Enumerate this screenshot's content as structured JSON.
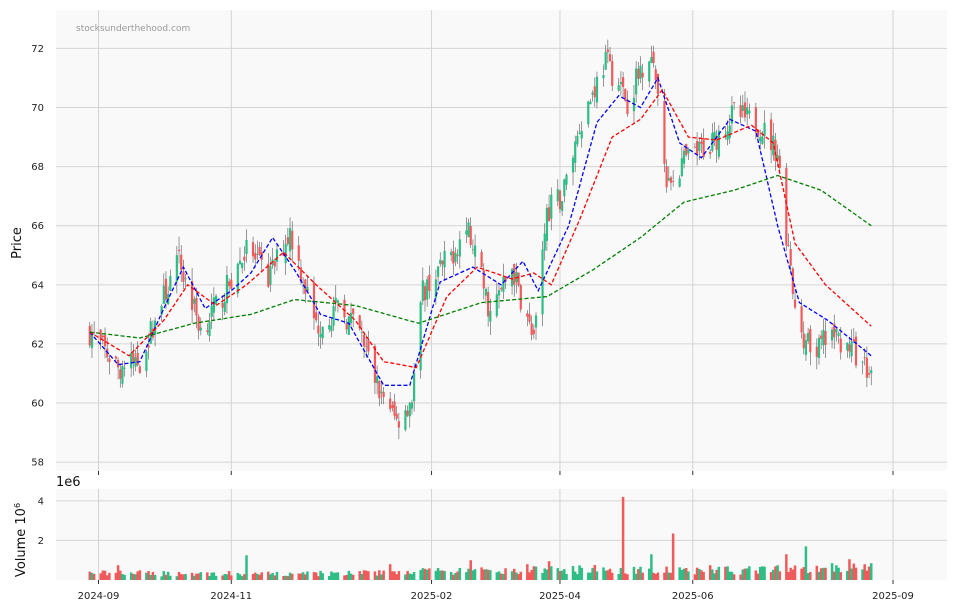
{
  "watermark": "stocksunderthehood.com",
  "chart_data": [
    {
      "type": "candlestick",
      "ylabel": "Price",
      "ylim": [
        57.7,
        73.3
      ],
      "yticks": [
        58,
        60,
        62,
        64,
        66,
        68,
        70,
        72
      ],
      "xticks": [
        "2024-09",
        "2024-11",
        "2025-02",
        "2025-04",
        "2025-06",
        "2025-09"
      ],
      "grid": true,
      "colors": {
        "up": "#2ebd85",
        "down": "#f05a5a",
        "ma_fast": "#0000ff",
        "ma_mid": "#ff0000",
        "ma_slow": "#008000"
      },
      "close_keypoints": [
        {
          "date": "2024-08-28",
          "value": 62.4
        },
        {
          "date": "2024-09-10",
          "value": 61.2
        },
        {
          "date": "2024-09-20",
          "value": 61.4
        },
        {
          "date": "2024-10-01",
          "value": 63.6
        },
        {
          "date": "2024-10-08",
          "value": 64.8
        },
        {
          "date": "2024-10-18",
          "value": 62.5
        },
        {
          "date": "2024-10-28",
          "value": 63.6
        },
        {
          "date": "2024-11-08",
          "value": 65.2
        },
        {
          "date": "2024-11-18",
          "value": 64.2
        },
        {
          "date": "2024-11-28",
          "value": 65.8
        },
        {
          "date": "2024-12-10",
          "value": 62.6
        },
        {
          "date": "2024-12-20",
          "value": 63.2
        },
        {
          "date": "2024-12-30",
          "value": 62.4
        },
        {
          "date": "2025-01-08",
          "value": 60.4
        },
        {
          "date": "2025-01-16",
          "value": 59.4
        },
        {
          "date": "2025-01-23",
          "value": 60.2
        },
        {
          "date": "2025-01-28",
          "value": 63.8
        },
        {
          "date": "2025-02-10",
          "value": 65.0
        },
        {
          "date": "2025-02-18",
          "value": 66.0
        },
        {
          "date": "2025-02-28",
          "value": 63.0
        },
        {
          "date": "2025-03-10",
          "value": 64.6
        },
        {
          "date": "2025-03-20",
          "value": 62.0
        },
        {
          "date": "2025-03-26",
          "value": 66.5
        },
        {
          "date": "2025-04-02",
          "value": 67.0
        },
        {
          "date": "2025-04-10",
          "value": 69.4
        },
        {
          "date": "2025-04-22",
          "value": 71.6
        },
        {
          "date": "2025-05-02",
          "value": 70.2
        },
        {
          "date": "2025-05-12",
          "value": 72.0
        },
        {
          "date": "2025-05-16",
          "value": 70.4
        },
        {
          "date": "2025-05-20",
          "value": 67.2
        },
        {
          "date": "2025-05-28",
          "value": 68.2
        },
        {
          "date": "2025-06-10",
          "value": 68.8
        },
        {
          "date": "2025-06-20",
          "value": 69.8
        },
        {
          "date": "2025-07-02",
          "value": 69.4
        },
        {
          "date": "2025-07-10",
          "value": 68.5
        },
        {
          "date": "2025-07-18",
          "value": 63.0
        },
        {
          "date": "2025-07-26",
          "value": 61.6
        },
        {
          "date": "2025-08-04",
          "value": 62.4
        },
        {
          "date": "2025-08-12",
          "value": 61.9
        },
        {
          "date": "2025-08-22",
          "value": 61.0
        }
      ],
      "ma_fast": [
        {
          "date": "2024-08-28",
          "value": 62.4
        },
        {
          "date": "2024-09-10",
          "value": 61.3
        },
        {
          "date": "2024-09-20",
          "value": 61.4
        },
        {
          "date": "2024-10-01",
          "value": 63.2
        },
        {
          "date": "2024-10-10",
          "value": 64.6
        },
        {
          "date": "2024-10-20",
          "value": 63.2
        },
        {
          "date": "2024-11-01",
          "value": 63.8
        },
        {
          "date": "2024-11-10",
          "value": 64.4
        },
        {
          "date": "2024-11-20",
          "value": 65.6
        },
        {
          "date": "2024-12-01",
          "value": 64.4
        },
        {
          "date": "2024-12-12",
          "value": 63.0
        },
        {
          "date": "2024-12-25",
          "value": 62.7
        },
        {
          "date": "2025-01-10",
          "value": 60.6
        },
        {
          "date": "2025-01-22",
          "value": 60.6
        },
        {
          "date": "2025-02-05",
          "value": 64.1
        },
        {
          "date": "2025-02-20",
          "value": 64.6
        },
        {
          "date": "2025-03-05",
          "value": 64.0
        },
        {
          "date": "2025-03-15",
          "value": 64.8
        },
        {
          "date": "2025-03-22",
          "value": 63.8
        },
        {
          "date": "2025-04-05",
          "value": 66.0
        },
        {
          "date": "2025-04-18",
          "value": 69.5
        },
        {
          "date": "2025-04-28",
          "value": 70.4
        },
        {
          "date": "2025-05-08",
          "value": 70.0
        },
        {
          "date": "2025-05-16",
          "value": 71.0
        },
        {
          "date": "2025-05-26",
          "value": 68.8
        },
        {
          "date": "2025-06-05",
          "value": 68.3
        },
        {
          "date": "2025-06-18",
          "value": 69.6
        },
        {
          "date": "2025-06-30",
          "value": 69.2
        },
        {
          "date": "2025-07-10",
          "value": 66.0
        },
        {
          "date": "2025-07-20",
          "value": 63.4
        },
        {
          "date": "2025-08-02",
          "value": 62.8
        },
        {
          "date": "2025-08-22",
          "value": 61.6
        }
      ],
      "ma_mid": [
        {
          "date": "2024-08-28",
          "value": 62.4
        },
        {
          "date": "2024-09-15",
          "value": 61.6
        },
        {
          "date": "2024-10-01",
          "value": 62.8
        },
        {
          "date": "2024-10-12",
          "value": 64.0
        },
        {
          "date": "2024-10-25",
          "value": 63.3
        },
        {
          "date": "2024-11-08",
          "value": 64.0
        },
        {
          "date": "2024-11-25",
          "value": 65.1
        },
        {
          "date": "2024-12-10",
          "value": 64.0
        },
        {
          "date": "2024-12-28",
          "value": 62.8
        },
        {
          "date": "2025-01-10",
          "value": 61.4
        },
        {
          "date": "2025-01-25",
          "value": 61.2
        },
        {
          "date": "2025-02-08",
          "value": 63.6
        },
        {
          "date": "2025-02-22",
          "value": 64.6
        },
        {
          "date": "2025-03-10",
          "value": 64.2
        },
        {
          "date": "2025-03-20",
          "value": 64.4
        },
        {
          "date": "2025-03-28",
          "value": 64.0
        },
        {
          "date": "2025-04-10",
          "value": 66.2
        },
        {
          "date": "2025-04-25",
          "value": 69.0
        },
        {
          "date": "2025-05-08",
          "value": 69.6
        },
        {
          "date": "2025-05-18",
          "value": 70.6
        },
        {
          "date": "2025-05-30",
          "value": 69.0
        },
        {
          "date": "2025-06-12",
          "value": 68.9
        },
        {
          "date": "2025-06-28",
          "value": 69.4
        },
        {
          "date": "2025-07-08",
          "value": 68.8
        },
        {
          "date": "2025-07-18",
          "value": 65.4
        },
        {
          "date": "2025-08-01",
          "value": 64.0
        },
        {
          "date": "2025-08-22",
          "value": 62.6
        }
      ],
      "ma_slow": [
        {
          "date": "2024-08-28",
          "value": 62.4
        },
        {
          "date": "2024-09-20",
          "value": 62.2
        },
        {
          "date": "2024-10-15",
          "value": 62.7
        },
        {
          "date": "2024-11-10",
          "value": 63.0
        },
        {
          "date": "2024-11-30",
          "value": 63.5
        },
        {
          "date": "2024-12-28",
          "value": 63.3
        },
        {
          "date": "2025-01-26",
          "value": 62.7
        },
        {
          "date": "2025-02-24",
          "value": 63.4
        },
        {
          "date": "2025-03-26",
          "value": 63.6
        },
        {
          "date": "2025-04-16",
          "value": 64.5
        },
        {
          "date": "2025-05-08",
          "value": 65.6
        },
        {
          "date": "2025-05-28",
          "value": 66.8
        },
        {
          "date": "2025-06-20",
          "value": 67.2
        },
        {
          "date": "2025-07-10",
          "value": 67.7
        },
        {
          "date": "2025-07-30",
          "value": 67.2
        },
        {
          "date": "2025-08-22",
          "value": 66.0
        }
      ]
    },
    {
      "type": "bar",
      "ylabel": "Volume",
      "ylabel_unit": "10^6",
      "offset_text": "1e6",
      "ylim": [
        0,
        4.6
      ],
      "yticks": [
        2,
        4
      ],
      "grid": true,
      "volume_baseline": [
        {
          "date": "2024-08-28",
          "value": 0.35
        },
        {
          "date": "2024-12-01",
          "value": 0.3
        },
        {
          "date": "2025-01-15",
          "value": 0.4
        },
        {
          "date": "2025-03-01",
          "value": 0.45
        },
        {
          "date": "2025-04-20",
          "value": 0.55
        },
        {
          "date": "2025-06-01",
          "value": 0.45
        },
        {
          "date": "2025-08-22",
          "value": 0.6
        }
      ],
      "volume_spikes": [
        {
          "date": "2024-09-10",
          "value": 0.75
        },
        {
          "date": "2024-11-08",
          "value": 1.25
        },
        {
          "date": "2025-01-13",
          "value": 0.8
        },
        {
          "date": "2025-02-19",
          "value": 1.0
        },
        {
          "date": "2025-03-17",
          "value": 0.8
        },
        {
          "date": "2025-03-27",
          "value": 0.95
        },
        {
          "date": "2025-04-30",
          "value": 4.2
        },
        {
          "date": "2025-05-13",
          "value": 1.3
        },
        {
          "date": "2025-05-23",
          "value": 2.35
        },
        {
          "date": "2025-06-09",
          "value": 0.75
        },
        {
          "date": "2025-07-14",
          "value": 1.3
        },
        {
          "date": "2025-07-23",
          "value": 1.7
        },
        {
          "date": "2025-08-04",
          "value": 0.85
        },
        {
          "date": "2025-08-12",
          "value": 1.05
        }
      ]
    }
  ]
}
